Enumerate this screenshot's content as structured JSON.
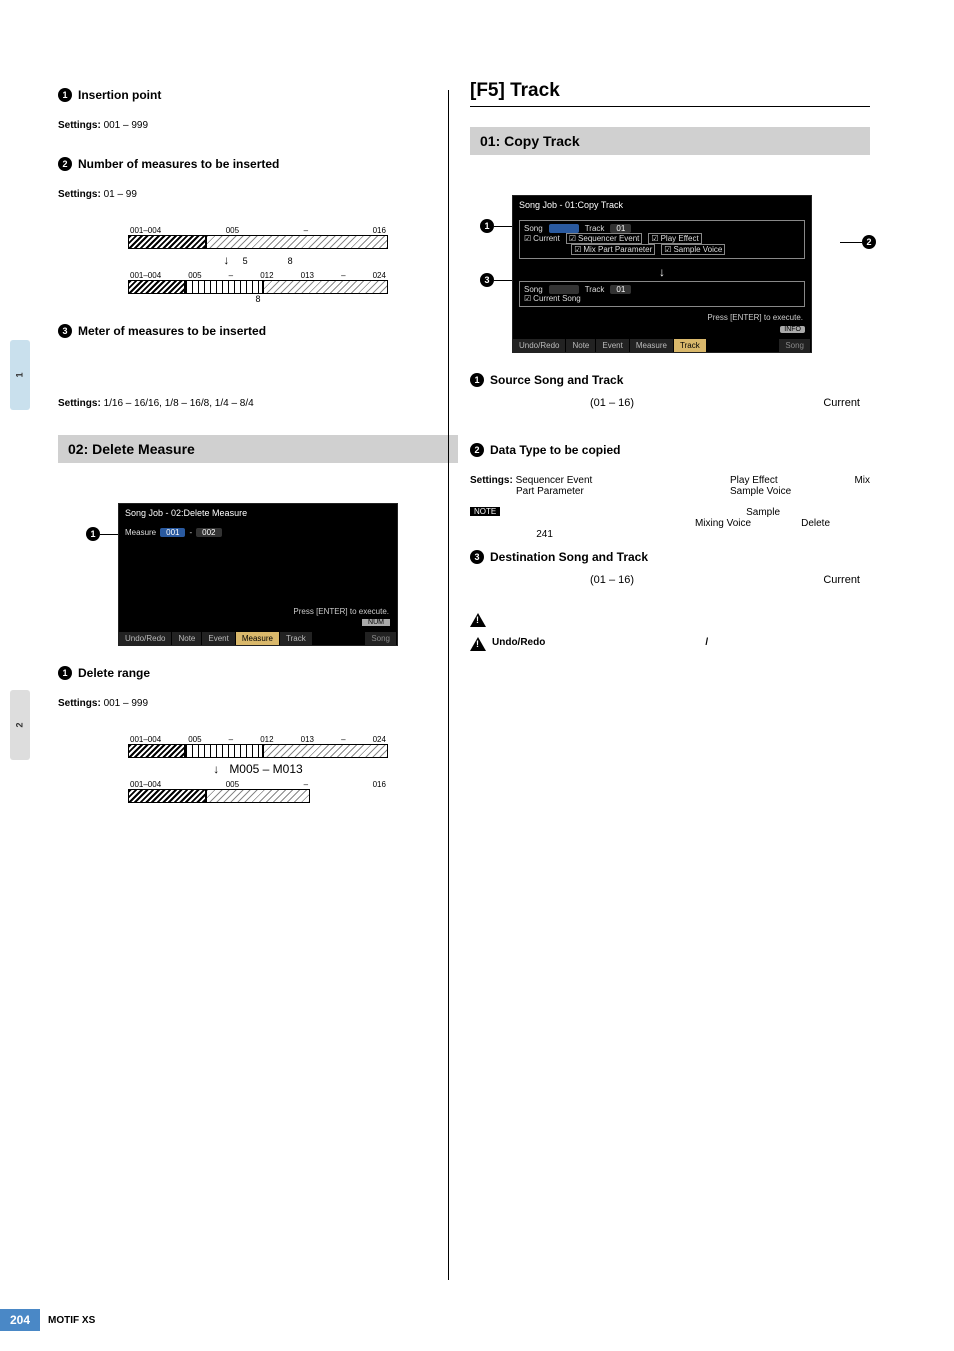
{
  "footer": {
    "page": "204",
    "title": "MOTIF XS"
  },
  "left": {
    "p1": {
      "title": "Insertion point",
      "settings_label": "Settings:",
      "settings": "001 – 999"
    },
    "p2": {
      "title": "Number of measures to be inserted",
      "settings_label": "Settings:",
      "settings": "01 – 99"
    },
    "d_insert": {
      "row1_a": "001–004",
      "row1_b": "005",
      "row1_dash": "–",
      "row1_c": "016",
      "mid_a": "5",
      "mid_b": "8",
      "row2_a": "001–004",
      "row2_b": "005",
      "row2_dash": "–",
      "row2_c": "012",
      "row2_d": "013",
      "row2_dash2": "–",
      "row2_e": "024",
      "bottom": "8"
    },
    "p3": {
      "title": "Meter of measures to be inserted",
      "settings_label": "Settings:",
      "settings": "1/16 – 16/16, 1/8 – 16/8, 1/4 – 8/4"
    },
    "h_delete": "02: Delete Measure",
    "lcd1": {
      "title": "Song Job - 02:Delete Measure",
      "measure_label": "Measure",
      "m_from": "001",
      "m_dash": "-",
      "m_to": "002",
      "enter": "Press [ENTER] to execute.",
      "num": "NUM",
      "tabs": [
        "Undo/Redo",
        "Note",
        "Event",
        "Measure",
        "Track",
        "Song"
      ]
    },
    "pDel": {
      "title": "Delete range",
      "settings_label": "Settings:",
      "settings": "001 – 999"
    },
    "d_delete": {
      "row1_a": "001–004",
      "row1_b": "005",
      "row1_dash": "–",
      "row1_c": "012",
      "row1_d": "013",
      "row1_dash2": "–",
      "row1_e": "024",
      "mid": "M005 – M013",
      "row2_a": "001–004",
      "row2_b": "005",
      "row2_dash": "–",
      "row2_c": "016"
    }
  },
  "right": {
    "h1": "[F5] Track",
    "h2": "01: Copy Track",
    "lcd2": {
      "title": "Song Job - 01:Copy Track",
      "src_song": "Song",
      "src_track": "Track",
      "src_tval": "01",
      "chk_current": "Current",
      "chk_seq": "Sequencer Event",
      "chk_play": "Play Effect",
      "chk_mix": "Mix Part Parameter",
      "chk_smp": "Sample Voice",
      "dst_song": "Song",
      "dst_track": "Track",
      "dst_tval": "01",
      "dst_cur": "Current Song",
      "enter": "Press [ENTER] to execute.",
      "info": "INFO",
      "tabs": [
        "Undo/Redo",
        "Note",
        "Event",
        "Measure",
        "Track",
        "Song"
      ]
    },
    "p1": {
      "title": "Source Song and Track",
      "range": "(01 – 16)",
      "right": "Current"
    },
    "p2": {
      "title": "Data Type to be copied",
      "settings_label": "Settings:",
      "s1": "Sequencer Event",
      "s2": "Play Effect",
      "s3": "Mix",
      "s4": "Part Parameter",
      "s5": "Sample Voice"
    },
    "note": {
      "l1": "Sample",
      "l2a": "Mixing Voice",
      "l2b": "Delete",
      "l3": "241"
    },
    "p3": {
      "title": "Destination Song and Track",
      "range": "(01 – 16)",
      "right": "Current"
    },
    "caution2": {
      "l1": "Undo/Redo",
      "l2": "/"
    }
  }
}
